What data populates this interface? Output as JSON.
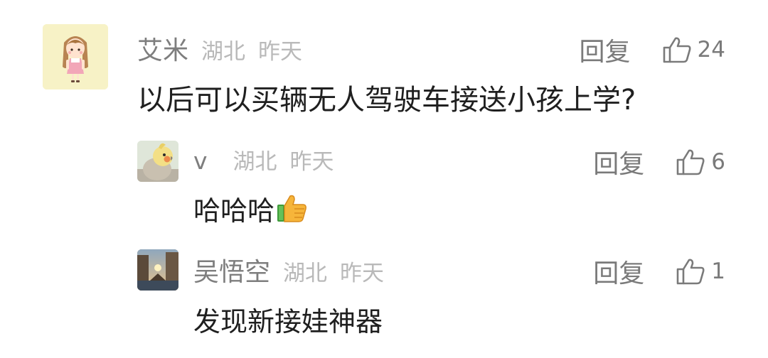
{
  "comments": [
    {
      "author": "艾米",
      "location": "湖北",
      "time": "昨天",
      "text": "以后可以买辆无人驾驶车接送小孩上学?",
      "reply_label": "回复",
      "like_count": "24",
      "avatar": "cartoon-girl-avatar"
    },
    {
      "author": "v",
      "location": "湖北",
      "time": "昨天",
      "text": "哈哈哈",
      "emoji": "thumbs-up",
      "reply_label": "回复",
      "like_count": "6",
      "avatar": "cockatiel-avatar"
    },
    {
      "author": "吴悟空",
      "location": "湖北",
      "time": "昨天",
      "text": "发现新接娃神器",
      "reply_label": "回复",
      "like_count": "1",
      "avatar": "landscape-avatar"
    }
  ],
  "colors": {
    "author": "#7e7e7e",
    "meta": "#b9b9b9",
    "text": "#1f1f1f",
    "action": "#7a7a7a"
  }
}
